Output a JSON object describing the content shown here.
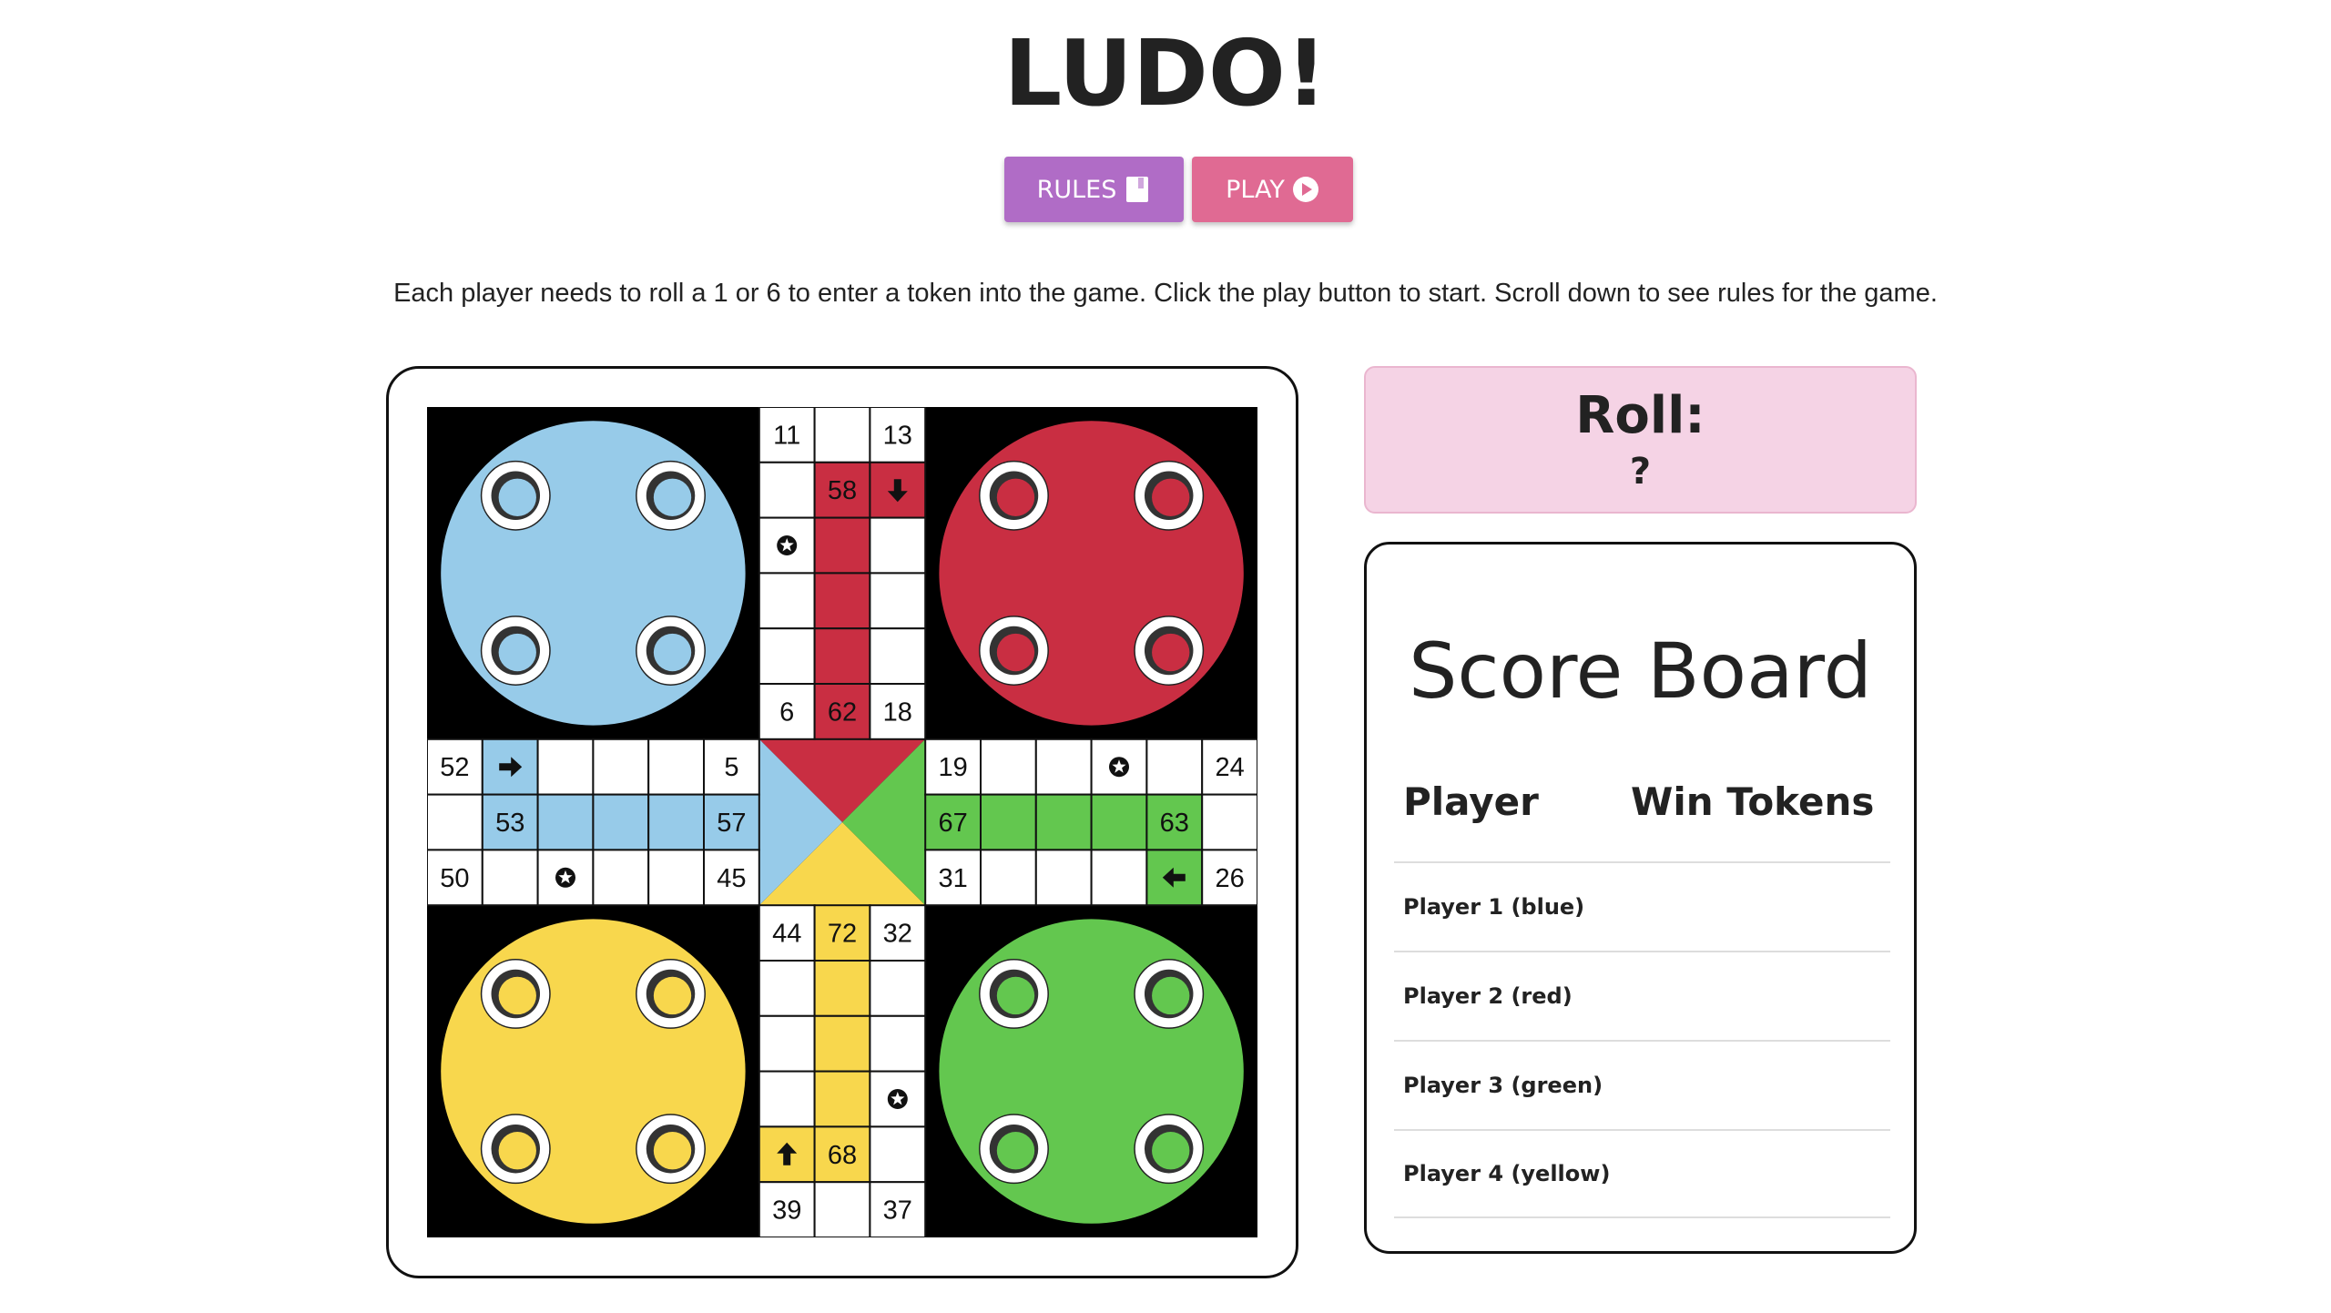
{
  "title": "LUDO!",
  "buttons": {
    "rules_label": "RULES",
    "play_label": "PLAY",
    "rules_color": "#b06cc6",
    "play_color": "#e06a93",
    "rules_icon": "book-icon",
    "play_icon": "play-circle-icon"
  },
  "intro": "Each player needs to roll a 1 or 6 to enter a token into the game. Click the play button to start. Scroll down to see rules for the game.",
  "roll": {
    "label": "Roll:",
    "value": "?"
  },
  "scoreboard": {
    "title": "Score Board",
    "headers": [
      "Player",
      "Win Tokens"
    ],
    "rows": [
      {
        "player": "Player 1 (blue)",
        "wins": ""
      },
      {
        "player": "Player 2 (red)",
        "wins": ""
      },
      {
        "player": "Player 3 (green)",
        "wins": ""
      },
      {
        "player": "Player 4 (yellow)",
        "wins": ""
      }
    ]
  },
  "colors": {
    "blue": "#97cbe9",
    "red": "#c92e42",
    "green": "#63c74f",
    "yellow": "#f8d74d",
    "board_bg": "#000000",
    "roll_bg": "#f5d3e5"
  },
  "board": {
    "top_cells": [
      "11",
      "",
      "13",
      "",
      "58",
      "",
      "",
      "",
      "",
      "",
      "",
      "",
      "",
      "",
      "",
      "6",
      "62",
      "18"
    ],
    "top_icons": {
      "5": "arrow-down-icon",
      "6": "star-icon"
    },
    "left_cells": [
      "52",
      "",
      "",
      "",
      "",
      "5",
      "",
      "53",
      "",
      "",
      "",
      "57",
      "50",
      "",
      "",
      "",
      "",
      "45"
    ],
    "left_icons": {
      "1": "arrow-right-icon",
      "14": "star-icon"
    },
    "right_cells": [
      "19",
      "",
      "",
      "",
      "",
      "24",
      "67",
      "",
      "",
      "",
      "63",
      "",
      "31",
      "",
      "",
      "",
      "",
      "26"
    ],
    "right_icons": {
      "3": "star-icon",
      "16": "arrow-left-icon"
    },
    "bottom_cells": [
      "44",
      "72",
      "32",
      "",
      "",
      "",
      "",
      "",
      "",
      "",
      "",
      "",
      "",
      "68",
      "",
      "39",
      "",
      "37"
    ],
    "bottom_icons": {
      "11": "star-icon",
      "12": "arrow-up-icon"
    }
  }
}
